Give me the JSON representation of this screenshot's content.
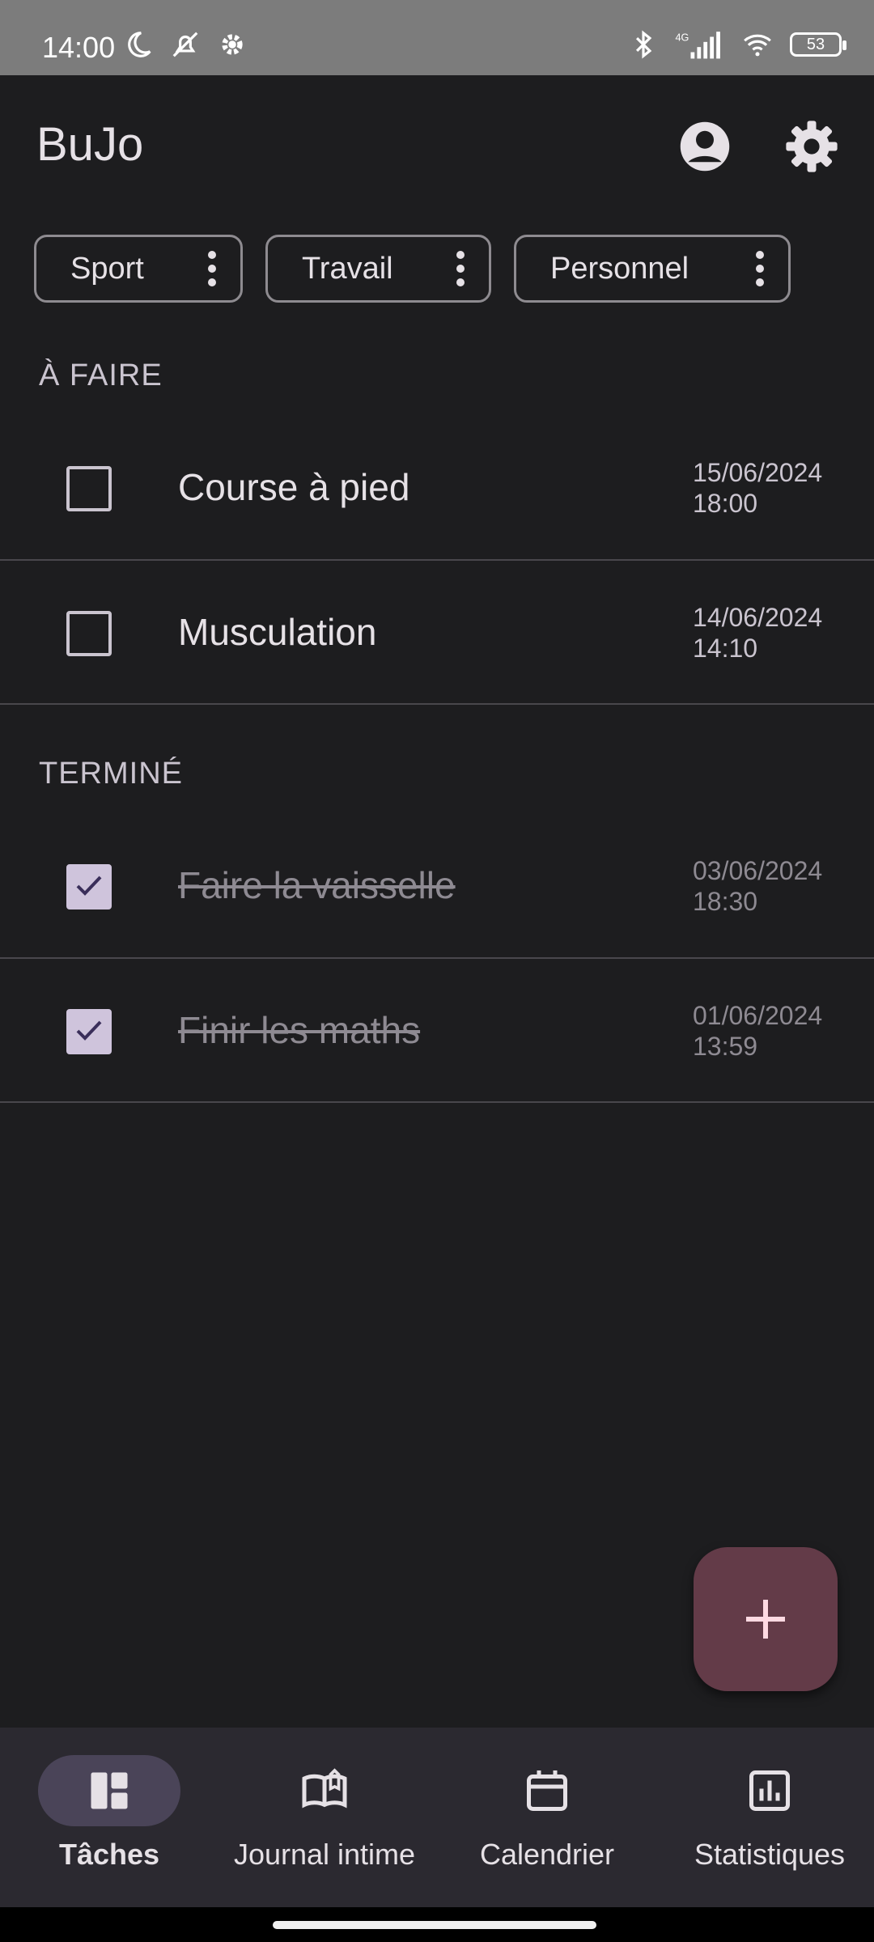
{
  "status_bar": {
    "time": "14:00",
    "battery": "53",
    "network": "4G",
    "icons_left": [
      "moon-icon",
      "notifications-off-icon",
      "gear-icon"
    ],
    "icons_right": [
      "bluetooth-icon",
      "signal-icon",
      "wifi-icon",
      "battery-icon"
    ]
  },
  "app_bar": {
    "title": "BuJo",
    "actions": [
      "account-icon",
      "settings-icon"
    ]
  },
  "categories": [
    {
      "label": "Sport"
    },
    {
      "label": "Travail"
    },
    {
      "label": "Personnel"
    }
  ],
  "sections": {
    "todo": {
      "header": "À FAIRE",
      "tasks": [
        {
          "title": "Course à pied",
          "date": "15/06/2024",
          "time": "18:00",
          "done": false
        },
        {
          "title": "Musculation",
          "date": "14/06/2024",
          "time": "14:10",
          "done": false
        }
      ]
    },
    "done": {
      "header": "TERMINÉ",
      "tasks": [
        {
          "title": "Faire la vaisselle",
          "date": "03/06/2024",
          "time": "18:30",
          "done": true
        },
        {
          "title": "Finir les maths",
          "date": "01/06/2024",
          "time": "13:59",
          "done": true
        }
      ]
    }
  },
  "fab": {
    "icon": "plus-icon"
  },
  "bottom_nav": {
    "items": [
      {
        "label": "Tâches",
        "icon": "dashboard-icon",
        "active": true
      },
      {
        "label": "Journal intime",
        "icon": "book-icon",
        "active": false
      },
      {
        "label": "Calendrier",
        "icon": "calendar-icon",
        "active": false
      },
      {
        "label": "Statistiques",
        "icon": "chart-icon",
        "active": false
      }
    ]
  },
  "colors": {
    "background": "#1d1d1f",
    "fab": "#633b48",
    "nav_background": "#2b2930",
    "nav_active_pill": "#4a4458",
    "checkbox_checked": "#cfc4dc"
  }
}
